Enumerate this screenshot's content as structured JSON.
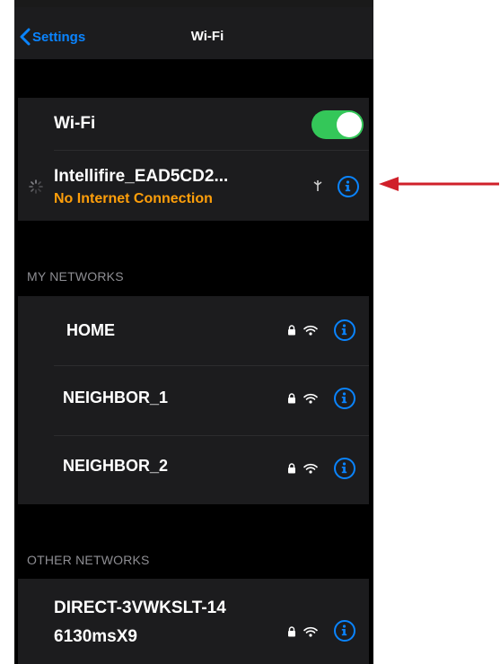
{
  "nav": {
    "back_label": "Settings",
    "title": "Wi-Fi"
  },
  "wifi_toggle": {
    "label": "Wi-Fi",
    "on": true
  },
  "current_network": {
    "name": "Intellifire_EAD5CD2...",
    "status": "No Internet Connection"
  },
  "my_networks": {
    "header": "MY NETWORKS",
    "items": [
      {
        "name": "HOME"
      },
      {
        "name": "NEIGHBOR_1"
      },
      {
        "name": "NEIGHBOR_2"
      }
    ]
  },
  "other_networks": {
    "header": "OTHER NETWORKS",
    "items": [
      {
        "name_line1": "DIRECT-3VWKSLT-14",
        "name_line2": "6130msX9"
      }
    ]
  },
  "colors": {
    "accent": "#0a84ff",
    "toggle_on": "#34c759",
    "warning": "#ff9f0a",
    "annotation_arrow": "#d0202a"
  },
  "icons": [
    "chevron-left-icon",
    "spinner-icon",
    "antenna-icon",
    "lock-icon",
    "wifi-icon",
    "info-icon",
    "arrow-icon"
  ]
}
